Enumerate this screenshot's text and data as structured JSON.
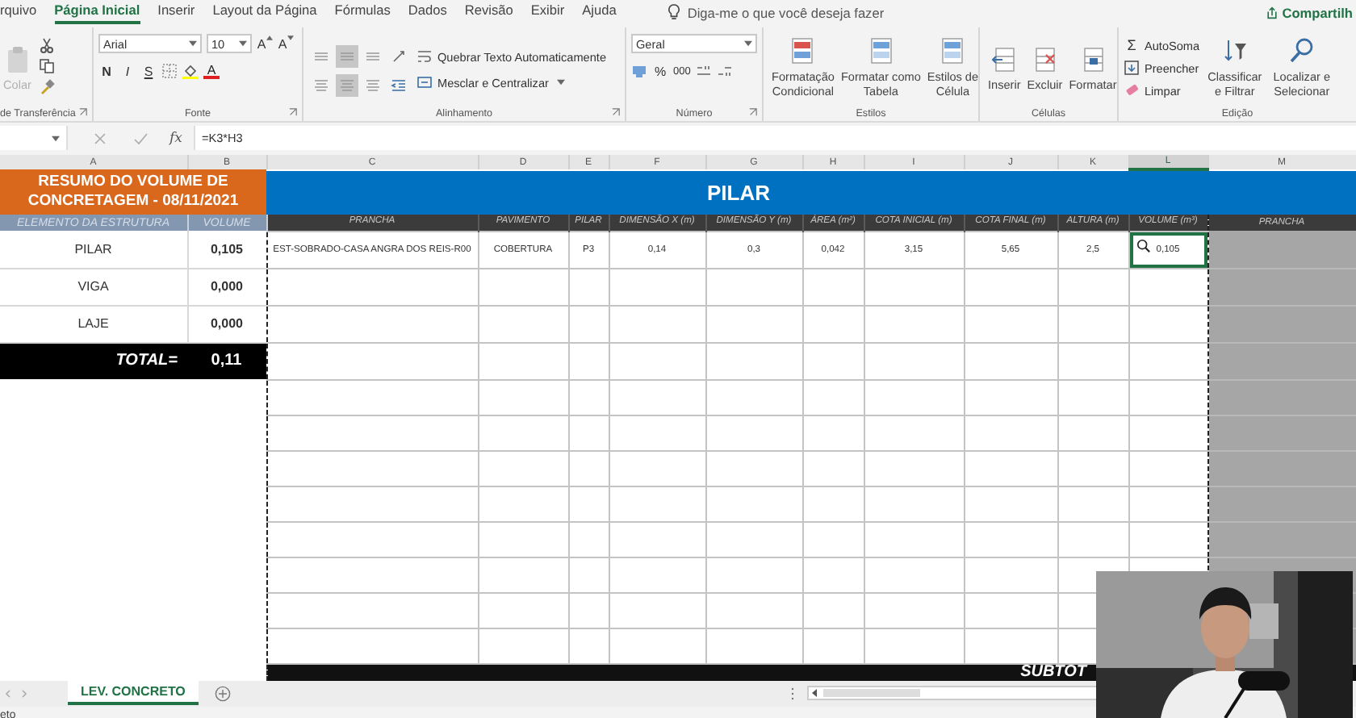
{
  "ribbon_tabs": [
    {
      "label": "rquivo",
      "selected": false
    },
    {
      "label": "Página Inicial",
      "selected": true
    },
    {
      "label": "Inserir",
      "selected": false
    },
    {
      "label": "Layout da Página",
      "selected": false
    },
    {
      "label": "Fórmulas",
      "selected": false
    },
    {
      "label": "Dados",
      "selected": false
    },
    {
      "label": "Revisão",
      "selected": false
    },
    {
      "label": "Exibir",
      "selected": false
    },
    {
      "label": "Ajuda",
      "selected": false
    }
  ],
  "tell_me": {
    "placeholder": "Diga-me o que você deseja fazer"
  },
  "share": "Compartilh",
  "ribbon": {
    "clipboard": {
      "paste": {
        "label": "Colar",
        "disabled": true
      },
      "label": "de Transferência"
    },
    "font": {
      "name": "Arial",
      "size": "10",
      "grow": "A",
      "shrink": "A",
      "bold": "N",
      "italic": "I",
      "underline": "S",
      "tint_letter": "A",
      "label": "Fonte"
    },
    "alignment": {
      "wrap": "Quebrar Texto Automaticamente",
      "merge": "Mesclar e Centralizar",
      "label": "Alinhamento"
    },
    "number": {
      "format": "Geral",
      "percent": "%",
      "thousands": "000",
      "label": "Número"
    },
    "styles": {
      "buttons": [
        {
          "lines": [
            "Formatação",
            "Condicional"
          ]
        },
        {
          "lines": [
            "Formatar como",
            "Tabela"
          ]
        },
        {
          "lines": [
            "Estilos de",
            "Célula"
          ]
        }
      ],
      "label": "Estilos"
    },
    "cells": {
      "buttons": [
        {
          "lines": [
            "Inserir"
          ]
        },
        {
          "lines": [
            "Excluir"
          ]
        },
        {
          "lines": [
            "Formatar"
          ]
        }
      ],
      "label": "Células"
    },
    "editing": {
      "sigma": "Σ",
      "items": [
        "AutoSoma",
        "Preencher",
        "Limpar"
      ],
      "buttons": [
        {
          "lines": [
            "Classificar",
            "e Filtrar"
          ]
        },
        {
          "lines": [
            "Localizar e",
            "Selecionar"
          ]
        }
      ],
      "label": "Edição"
    }
  },
  "formula_bar": {
    "fx": "fx",
    "formula": "=K3*H3"
  },
  "column_headers": [
    {
      "label": "A",
      "selected": false
    },
    {
      "label": "B",
      "selected": false
    },
    {
      "label": "C",
      "selected": false
    },
    {
      "label": "D",
      "selected": false
    },
    {
      "label": "E",
      "selected": false
    },
    {
      "label": "F",
      "selected": false
    },
    {
      "label": "G",
      "selected": false
    },
    {
      "label": "H",
      "selected": false
    },
    {
      "label": "I",
      "selected": false
    },
    {
      "label": "J",
      "selected": false
    },
    {
      "label": "K",
      "selected": false
    },
    {
      "label": "L",
      "selected": true
    },
    {
      "label": "M",
      "selected": false
    }
  ],
  "summary": {
    "title": "RESUMO DO VOLUME DE CONCRETAGEM - 08/11/2021",
    "columns": [
      "ELEMENTO DA ESTRUTURA",
      "VOLUME"
    ],
    "rows": [
      {
        "element": "PILAR",
        "volume": "0,105"
      },
      {
        "element": "VIGA",
        "volume": "0,000"
      },
      {
        "element": "LAJE",
        "volume": "0,000"
      }
    ],
    "total_label": "TOTAL=",
    "total": "0,11"
  },
  "pilar": {
    "title": "PILAR",
    "columns": [
      "PRANCHA",
      "PAVIMENTO",
      "PILAR",
      "DIMENSÃO X (m)",
      "DIMENSÃO Y (m)",
      "ÁREA (m²)",
      "COTA INICIAL (m)",
      "COTA FINAL (m)",
      "ALTURA (m)",
      "VOLUME (m³)",
      "PRANCHA"
    ],
    "rows": [
      {
        "cells": [
          {
            "value": "EST-SOBRADO-CASA ANGRA DOS REIS-R00",
            "selected": false
          },
          {
            "value": "COBERTURA",
            "selected": false
          },
          {
            "value": "P3",
            "selected": false
          },
          {
            "value": "0,14",
            "selected": false
          },
          {
            "value": "0,3",
            "selected": false
          },
          {
            "value": "0,042",
            "selected": false
          },
          {
            "value": "3,15",
            "selected": false
          },
          {
            "value": "5,65",
            "selected": false
          },
          {
            "value": "2,5",
            "selected": false
          },
          {
            "value": "0,105",
            "selected": true
          }
        ]
      }
    ],
    "subtotal": "SUBTOT"
  },
  "sheet_tabs": [
    {
      "label": "LEV. CONCRETO",
      "selected": true
    }
  ],
  "status": "eto"
}
